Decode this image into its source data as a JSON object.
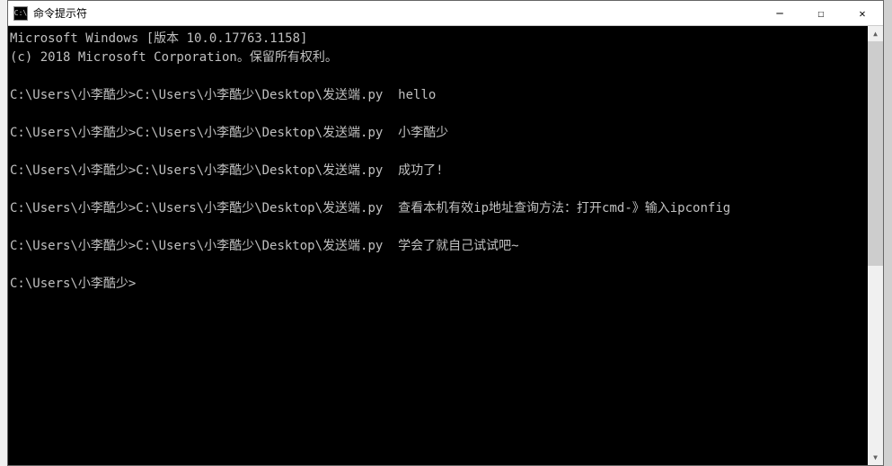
{
  "titlebar": {
    "icon_label": "C:\\",
    "title": "命令提示符"
  },
  "win_controls": {
    "minimize": "─",
    "maximize": "☐",
    "close": "✕"
  },
  "terminal": {
    "header1": "Microsoft Windows [版本 10.0.17763.1158]",
    "header2": "(c) 2018 Microsoft Corporation。保留所有权利。",
    "prompt_prefix": "C:\\Users\\小李酷少>",
    "script_path": "C:\\Users\\小李酷少\\Desktop\\发送端.py",
    "commands": [
      {
        "arg": "hello"
      },
      {
        "arg": "小李酷少"
      },
      {
        "arg": "成功了!"
      },
      {
        "arg": "查看本机有效ip地址查询方法：打开cmd-》输入ipconfig"
      },
      {
        "arg": "学会了就自己试试吧~"
      }
    ],
    "current_prompt": "C:\\Users\\小李酷少>"
  },
  "scroll": {
    "up": "▲",
    "down": "▼"
  }
}
